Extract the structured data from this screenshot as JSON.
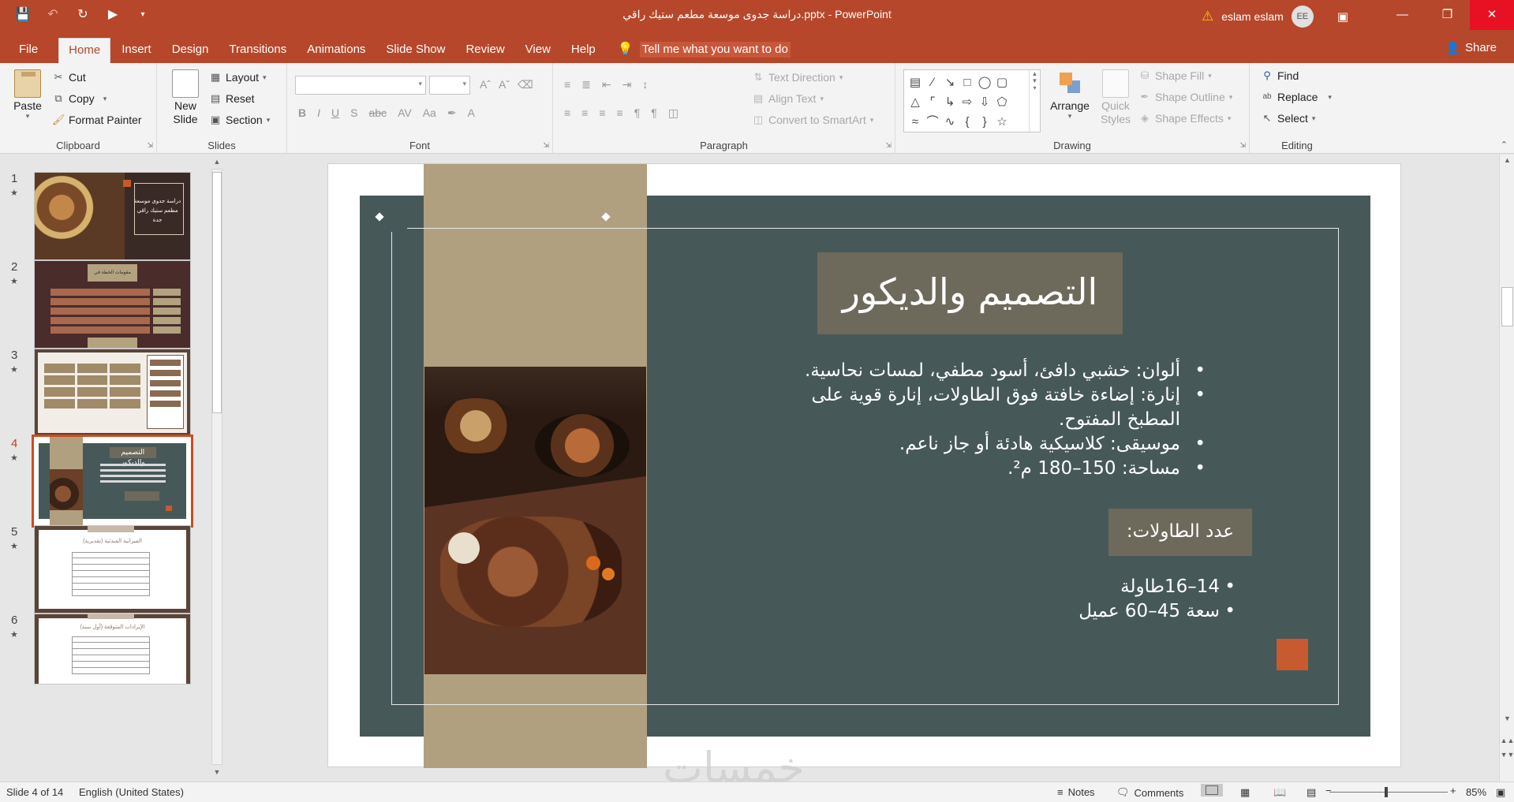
{
  "titlebar": {
    "doc_title": "دراسة جدوى موسعة مطعم ستيك راقي.pptx",
    "separator": " - ",
    "app_name": "PowerPoint",
    "user_name": "eslam eslam",
    "user_initials": "EE"
  },
  "qat": {
    "save_icon": "save-icon",
    "undo_icon": "undo-icon",
    "redo_icon": "redo-icon",
    "present_icon": "start-from-beginning-icon",
    "customize_icon": "customize-qat-icon"
  },
  "tabs": [
    {
      "label": "File"
    },
    {
      "label": "Home",
      "active": true
    },
    {
      "label": "Insert"
    },
    {
      "label": "Design"
    },
    {
      "label": "Transitions"
    },
    {
      "label": "Animations"
    },
    {
      "label": "Slide Show"
    },
    {
      "label": "Review"
    },
    {
      "label": "View"
    },
    {
      "label": "Help"
    }
  ],
  "tellme": "Tell me what you want to do",
  "share": "Share",
  "ribbon": {
    "clipboard": {
      "label": "Clipboard",
      "paste": "Paste",
      "cut": "Cut",
      "copy": "Copy",
      "format_painter": "Format Painter"
    },
    "slides": {
      "label": "Slides",
      "new_slide_line1": "New",
      "new_slide_line2": "Slide",
      "layout": "Layout",
      "reset": "Reset",
      "section": "Section"
    },
    "font": {
      "label": "Font",
      "font_name": "",
      "font_size": ""
    },
    "paragraph": {
      "label": "Paragraph",
      "text_direction": "Text Direction",
      "align_text": "Align Text",
      "convert_smartart": "Convert to SmartArt"
    },
    "drawing": {
      "label": "Drawing",
      "arrange": "Arrange",
      "quick_styles_line1": "Quick",
      "quick_styles_line2": "Styles",
      "shape_fill": "Shape Fill",
      "shape_outline": "Shape Outline",
      "shape_effects": "Shape Effects"
    },
    "editing": {
      "label": "Editing",
      "find": "Find",
      "replace": "Replace",
      "select": "Select"
    }
  },
  "slides_panel": [
    {
      "num": "1",
      "thumb_title": "دراسة جدوى موسعة",
      "thumb_sub": "مطعم ستيك راقي",
      "thumb_sub2": "جدة"
    },
    {
      "num": "2",
      "thumb_title": "مقومات الخطة في المشروع"
    },
    {
      "num": "3"
    },
    {
      "num": "4",
      "active": true,
      "thumb_title": "التصميم والديكور"
    },
    {
      "num": "5",
      "thumb_title": "الميزانية المبدئية (تقديرية)"
    },
    {
      "num": "6",
      "thumb_title": "الإيرادات المتوقعة (أول سنة)"
    }
  ],
  "slide": {
    "title": "التصميم والديكور",
    "bullets": [
      "ألوان: خشبي دافئ، أسود مطفي، لمسات نحاسية.",
      "إنارة: إضاءة خافتة فوق الطاولات، إنارة قوية على المطبخ المفتوح.",
      "موسيقى: كلاسيكية هادئة أو جاز ناعم.",
      "مساحة: 150–180 م²."
    ],
    "subheading": "عدد الطاولات:",
    "bullets2": [
      "14–16طاولة",
      "سعة 45–60 عميل"
    ],
    "photo": "steak-dinner-photo",
    "accent_color": "#c75a2e",
    "bg_color": "#475859",
    "band_color": "#b0a080",
    "title_box_color": "#6d6a5c"
  },
  "watermark": "خمسات",
  "statusbar": {
    "slide_info": "Slide 4 of 14",
    "language": "English (United States)",
    "notes": "Notes",
    "comments": "Comments",
    "zoom": "85%"
  },
  "colors": {
    "accent": "#b7472a",
    "ribbon_bg": "#f3f3f3",
    "selection": "#d04a1f"
  }
}
